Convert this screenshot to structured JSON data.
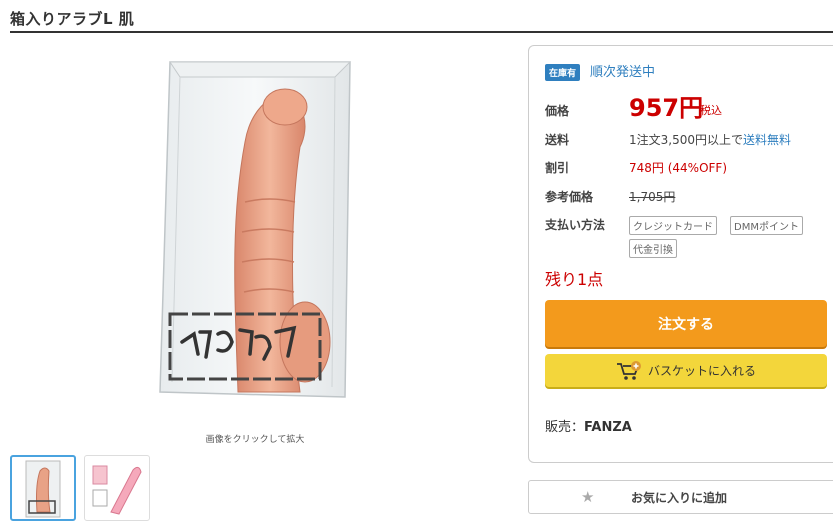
{
  "product": {
    "title": "箱入りアラブL 肌",
    "image_caption": "画像をクリックして拡大",
    "box_label_art": "箱入りアラブ"
  },
  "panel": {
    "stock_badge": "在庫有",
    "stock_status": "順次発送中",
    "price_label": "価格",
    "price": "957円",
    "price_tax": "税込",
    "shipping_label": "送料",
    "shipping_text": "1注文3,500円以上で",
    "shipping_free": "送料無料",
    "discount_label": "割引",
    "discount_value": "748円 (44%OFF)",
    "ref_price_label": "参考価格",
    "ref_price": "1,705円",
    "payment_label": "支払い方法",
    "payment_methods": [
      "クレジットカード",
      "DMMポイント",
      "代金引換"
    ],
    "remaining": "残り1点",
    "order_button": "注文する",
    "basket_button": "バスケットに入れる",
    "seller_label": "販売：",
    "seller_name": "FANZA"
  },
  "favorite": {
    "label": "お気に入りに追加",
    "icon": "star-icon"
  },
  "colors": {
    "price_red": "#cc0000",
    "link_blue": "#2f7fbf",
    "order_orange": "#f39a1c",
    "basket_yellow": "#f3d63b"
  }
}
